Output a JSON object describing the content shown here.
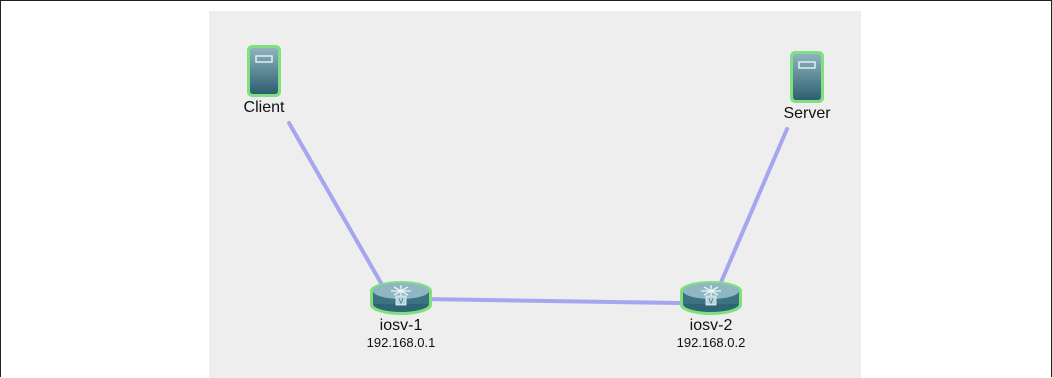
{
  "topology": {
    "link_color": "#a6a6f0",
    "node_outline_color": "#6fdc6f",
    "nodes": {
      "client": {
        "label": "Client",
        "icon": "server-tower-icon"
      },
      "server": {
        "label": "Server",
        "icon": "server-tower-icon"
      },
      "iosv1": {
        "label": "iosv-1",
        "ip": "192.168.0.1",
        "icon": "router-icon",
        "badge": "V"
      },
      "iosv2": {
        "label": "iosv-2",
        "ip": "192.168.0.2",
        "icon": "router-icon",
        "badge": "V"
      }
    },
    "links": [
      {
        "from": "Client",
        "to": "iosv-1"
      },
      {
        "from": "iosv-1",
        "to": "iosv-2"
      },
      {
        "from": "iosv-2",
        "to": "Server"
      }
    ]
  }
}
